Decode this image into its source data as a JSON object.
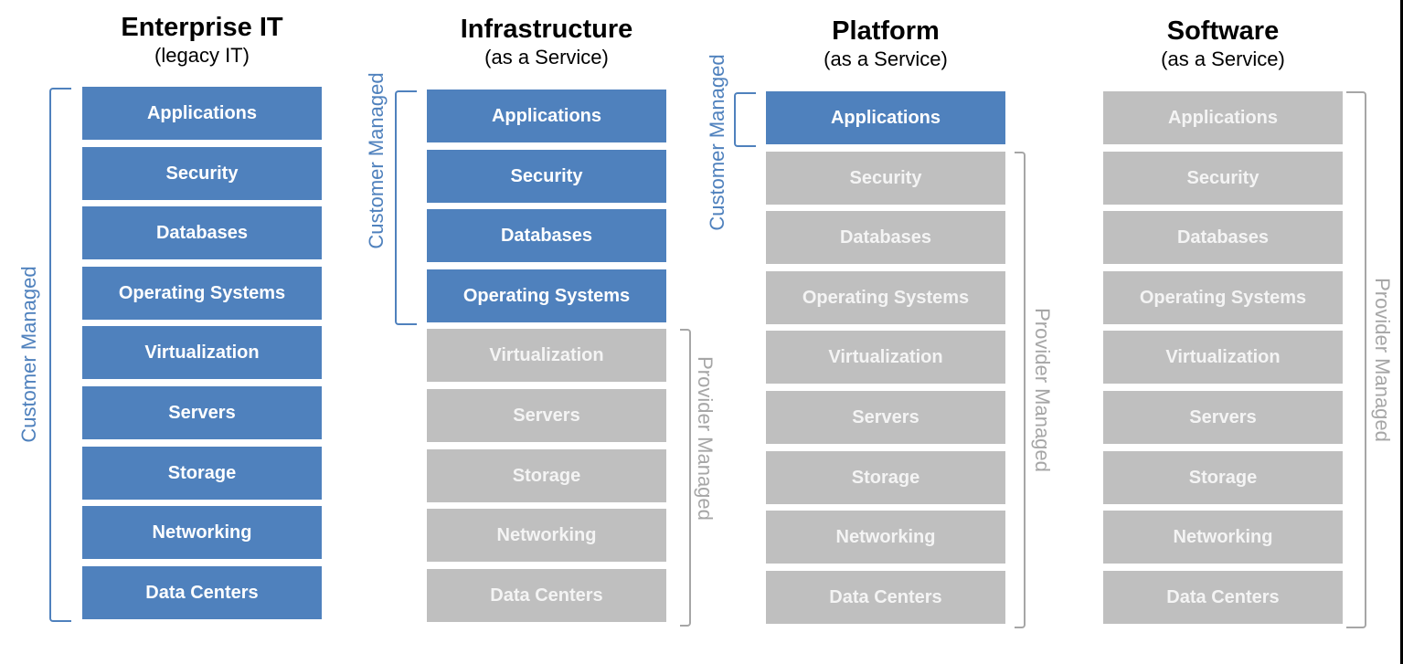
{
  "columns": [
    {
      "title": "Enterprise IT",
      "subtitle": "(legacy IT)",
      "customer_label": "Customer Managed",
      "provider_label": null,
      "customer_layers": 9
    },
    {
      "title": "Infrastructure",
      "subtitle": "(as a Service)",
      "customer_label": "Customer Managed",
      "provider_label": "Provider Managed",
      "customer_layers": 4
    },
    {
      "title": "Platform",
      "subtitle": "(as a Service)",
      "customer_label": "Customer Managed",
      "provider_label": "Provider Managed",
      "customer_layers": 1
    },
    {
      "title": "Software",
      "subtitle": "(as a Service)",
      "customer_label": null,
      "provider_label": "Provider Managed",
      "customer_layers": 0
    }
  ],
  "layers": [
    "Applications",
    "Security",
    "Databases",
    "Operating Systems",
    "Virtualization",
    "Servers",
    "Storage",
    "Networking",
    "Data Centers"
  ],
  "colors": {
    "customer": "#4F81BD",
    "provider": "#BFBFBF",
    "provider_text": "#A6A6A6"
  }
}
